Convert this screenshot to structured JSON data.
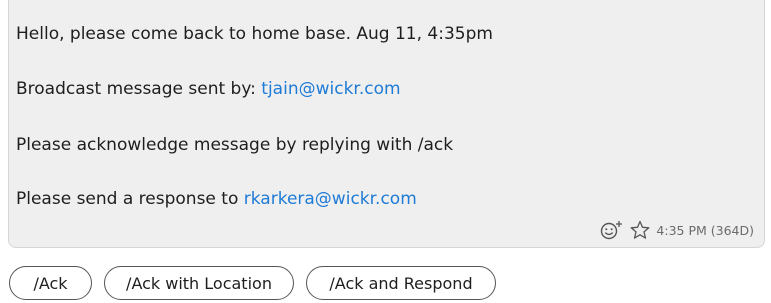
{
  "message": {
    "line1": "Hello, please come back to home base. Aug 11, 4:35pm",
    "line2_prefix": "Broadcast message sent by: ",
    "line2_link": "tjain@wickr.com",
    "line3": "Please acknowledge message by replying with /ack",
    "line4_prefix": "Please send a response to ",
    "line4_link": "rkarkera@wickr.com",
    "timestamp": "4:35 PM (364D)"
  },
  "icons": {
    "reaction": "add-reaction-icon",
    "favorite": "star-outline-icon"
  },
  "actions": [
    {
      "label": "/Ack"
    },
    {
      "label": "/Ack with Location"
    },
    {
      "label": "/Ack and Respond"
    }
  ],
  "colors": {
    "link": "#1e7bd6",
    "bubble_bg": "#efefef",
    "text": "#1e1e1e",
    "timestamp": "#6b6b6b"
  }
}
